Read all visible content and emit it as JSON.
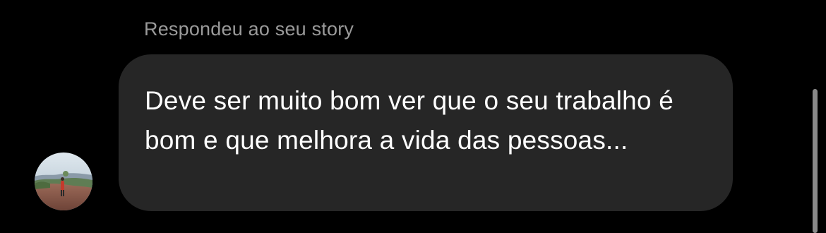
{
  "message": {
    "reply_context": "Respondeu ao seu story",
    "text": "Deve ser muito bom ver que o seu trabalho é bom e que melhora a vida das pessoas..."
  },
  "colors": {
    "background": "#000000",
    "bubble": "#262626",
    "text": "#ffffff",
    "secondary_text": "#9a9a9a"
  },
  "icons": {
    "avatar": "profile-photo",
    "scrollbar": "vertical-scrollbar"
  }
}
